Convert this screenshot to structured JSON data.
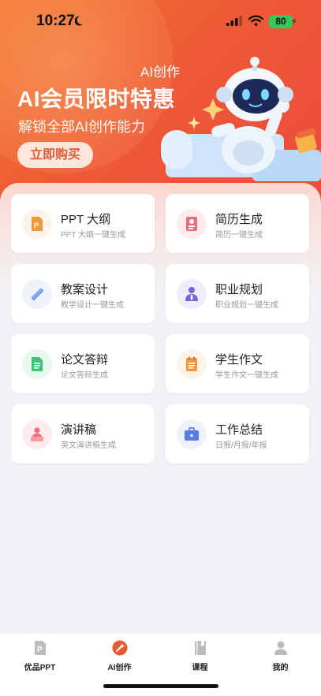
{
  "status_bar": {
    "time": "10:27",
    "battery": "80"
  },
  "hero": {
    "small_title": "AI创作",
    "title": "AI会员限时特惠",
    "subtitle": "解锁全部AI创作能力",
    "buy_label": "立即购买"
  },
  "cards": [
    {
      "title": "PPT 大纲",
      "desc": "PPT 大纲一键生成",
      "icon": "ppt-file-icon",
      "bg": "#fdf3e8",
      "color": "#f0993c"
    },
    {
      "title": "简历生成",
      "desc": "简历一键生成",
      "icon": "resume-icon",
      "bg": "#fdebee",
      "color": "#ef6b7b"
    },
    {
      "title": "教案设计",
      "desc": "教学设计一键生成",
      "icon": "ruler-pencil-icon",
      "bg": "#eef2fc",
      "color": "#5b7fe0"
    },
    {
      "title": "职业规划",
      "desc": "职业规划一键生成",
      "icon": "person-tie-icon",
      "bg": "#efedfb",
      "color": "#7667d8"
    },
    {
      "title": "论文答辩",
      "desc": "论文答辩生成",
      "icon": "document-lines-icon",
      "bg": "#e9f8ef",
      "color": "#3cc476"
    },
    {
      "title": "学生作文",
      "desc": "学生作文一键生成",
      "icon": "notepad-icon",
      "bg": "#fdf3e8",
      "color": "#f0993c"
    },
    {
      "title": "演讲稿",
      "desc": "英文演讲稿生成",
      "icon": "speaker-podium-icon",
      "bg": "#fdebee",
      "color": "#ef6b7b"
    },
    {
      "title": "工作总结",
      "desc": "日报/月报/年报",
      "icon": "briefcase-icon",
      "bg": "#eef2fc",
      "color": "#5b7fe0"
    }
  ],
  "tabs": [
    {
      "label": "优品PPT",
      "icon": "ppt-tab-icon",
      "active": false
    },
    {
      "label": "AI创作",
      "icon": "ai-create-icon",
      "active": true
    },
    {
      "label": "课程",
      "icon": "book-icon",
      "active": false
    },
    {
      "label": "我的",
      "icon": "user-icon",
      "active": false
    }
  ],
  "colors": {
    "accent": "#e9493f",
    "tab_active": "#e55a33",
    "tab_inactive": "#bcbcbc"
  }
}
